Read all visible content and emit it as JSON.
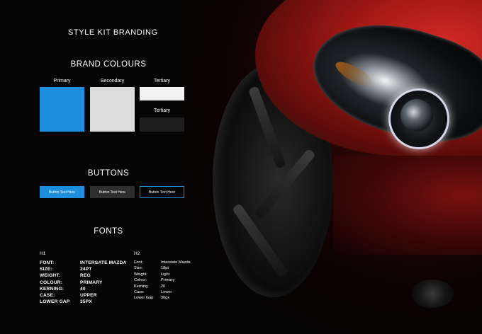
{
  "header": {
    "title": "STYLE KIT BRANDING"
  },
  "colours": {
    "heading": "BRAND COLOURS",
    "swatches": [
      {
        "label": "Primary",
        "color": "#1e8fdc"
      },
      {
        "label": "Secondary",
        "color": "#dcdcdc"
      },
      {
        "label": "Tertiary",
        "color": "#f1f1f1"
      },
      {
        "label": "Tertiary",
        "color": "#1f1f1f"
      }
    ]
  },
  "buttons": {
    "heading": "BUTTONS",
    "items": [
      {
        "label": "Button Text Here",
        "style": "primary-filled",
        "color": "#1e8fdc"
      },
      {
        "label": "Button Text Here",
        "style": "secondary-filled",
        "color": "#2e2e2e"
      },
      {
        "label": "Button Text Here",
        "style": "outline",
        "color": "#1e8fdc"
      }
    ]
  },
  "fonts": {
    "heading": "FONTS",
    "h1": {
      "heading": "H1",
      "rows": [
        {
          "key": "FONT:",
          "value": "INTERSATE MAZDA"
        },
        {
          "key": "SIZE:",
          "value": "24PT"
        },
        {
          "key": "WEIGHT:",
          "value": "REG"
        },
        {
          "key": "COLOUR:",
          "value": "PRIMARY"
        },
        {
          "key": "KERNING:",
          "value": "40"
        },
        {
          "key": "CASE:",
          "value": "UPPER"
        },
        {
          "key": "LOWER GAP",
          "value": "35PX"
        }
      ]
    },
    "h2": {
      "heading": "H2",
      "rows": [
        {
          "key": "Font:",
          "value": "Interstate Mazda"
        },
        {
          "key": "Size:",
          "value": "18pt"
        },
        {
          "key": "Weight:",
          "value": "Light"
        },
        {
          "key": "Colour:",
          "value": "Primary"
        },
        {
          "key": "Kerning:",
          "value": "20"
        },
        {
          "key": "Case:",
          "value": "Lower"
        },
        {
          "key": "Lower Gap",
          "value": "30px"
        }
      ]
    }
  },
  "icons": {
    "hero_image": "car-headlight-photo"
  }
}
